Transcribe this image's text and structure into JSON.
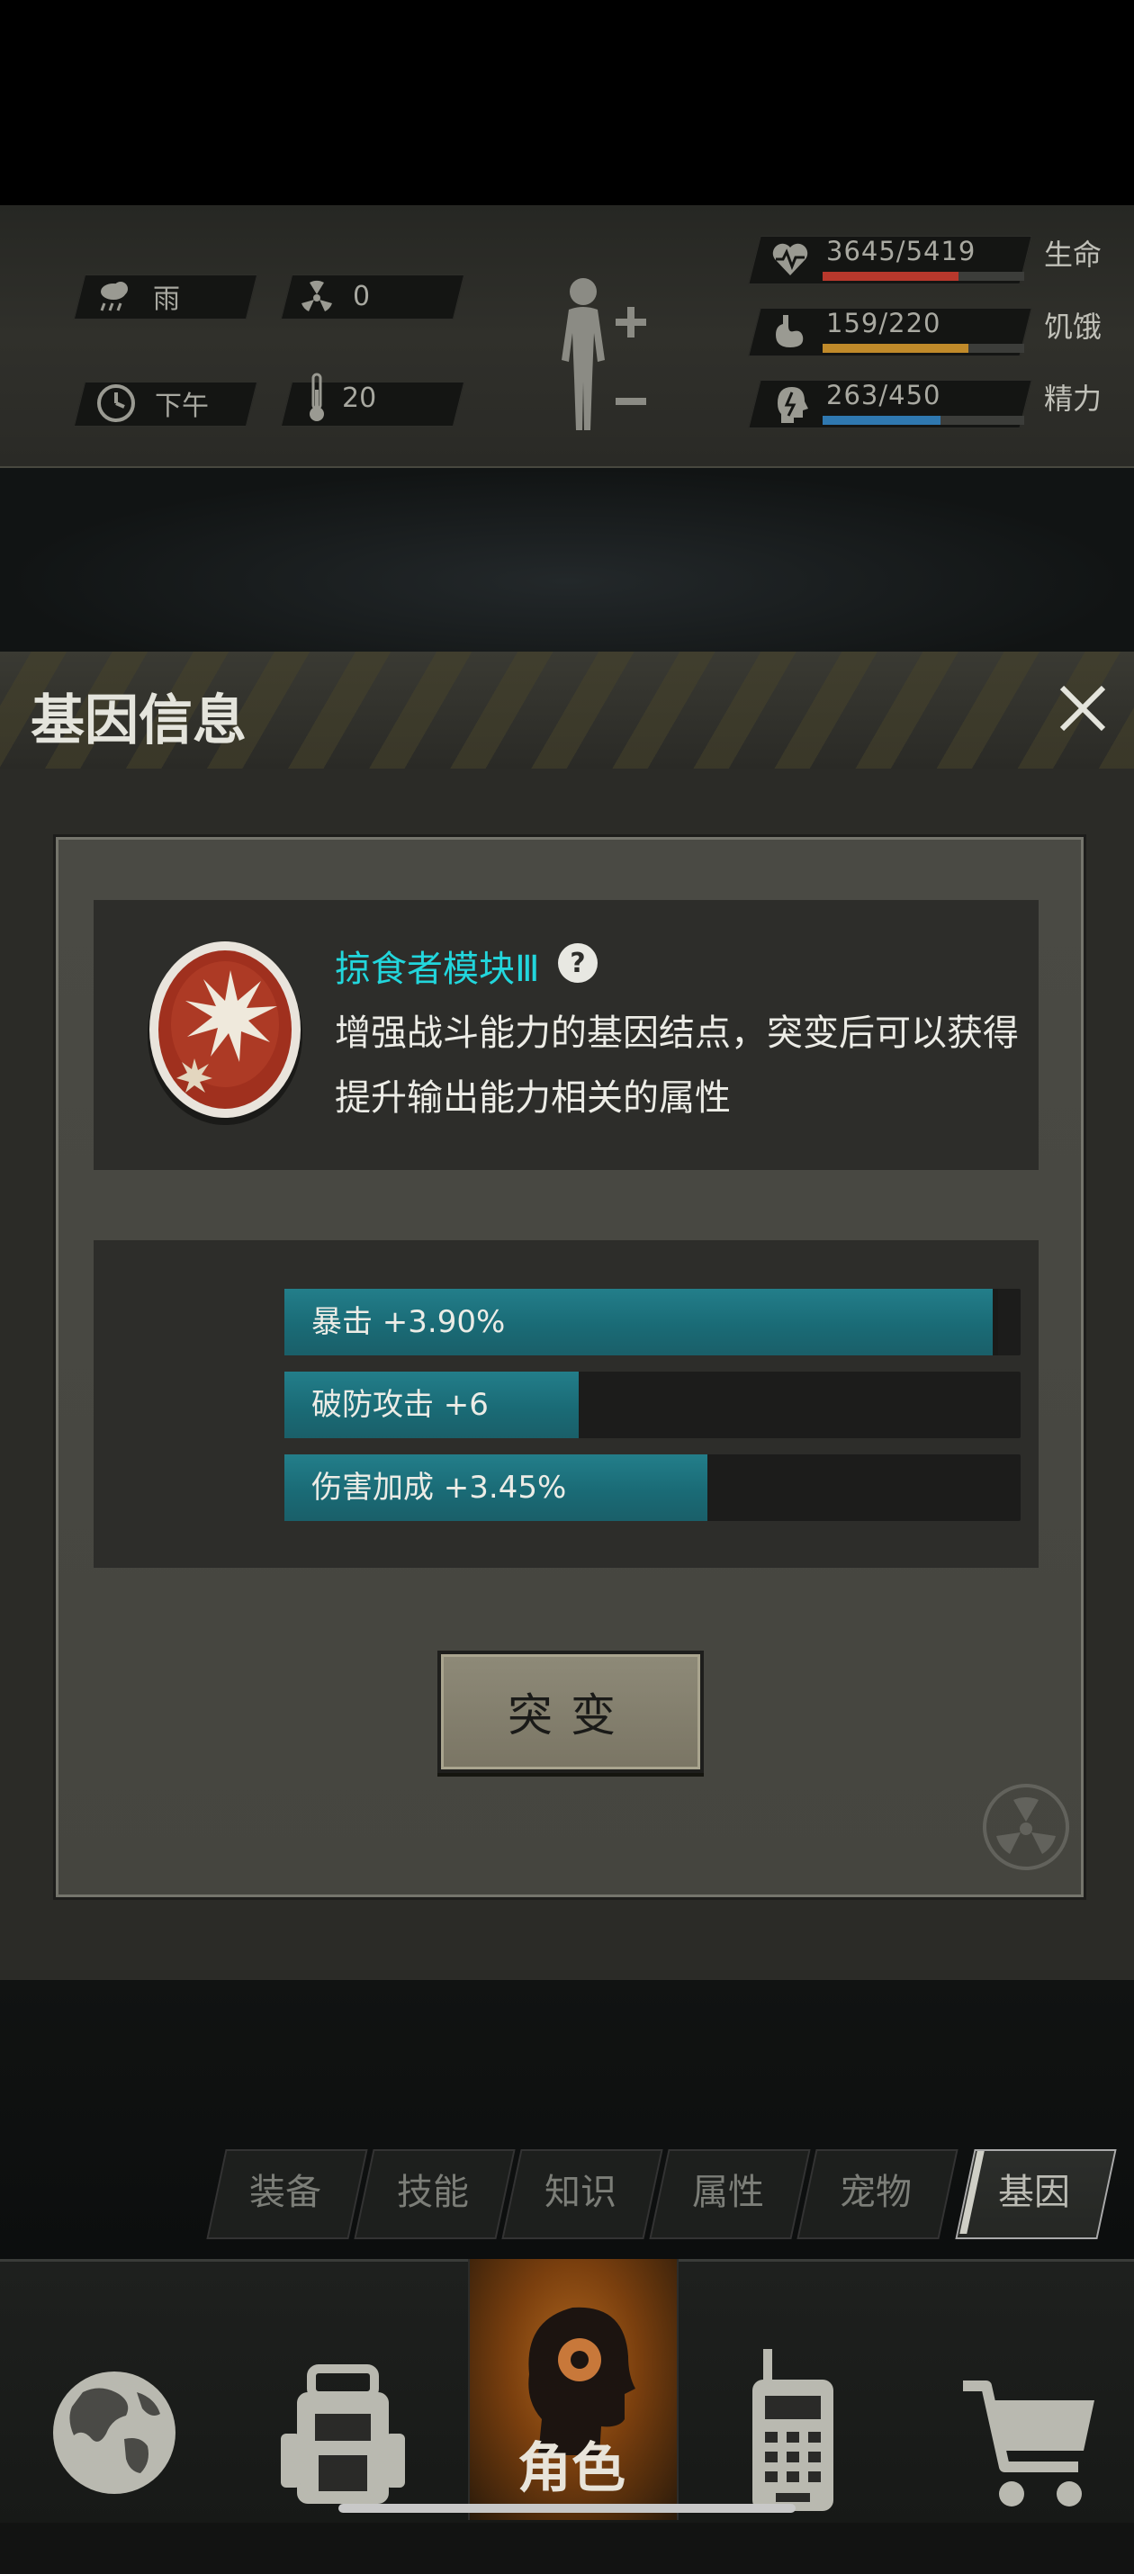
{
  "status": {
    "weather": {
      "icon": "rain-cloud-icon",
      "label": "雨"
    },
    "radiation": {
      "icon": "radiation-icon",
      "value": "0"
    },
    "time": {
      "icon": "clock-icon",
      "label": "下午"
    },
    "temperature": {
      "icon": "thermometer-icon",
      "value": "20"
    },
    "body_icon": "body-adjust-icon",
    "stats": [
      {
        "icon": "heart-rate-icon",
        "value": "3645/5419",
        "label": "生命",
        "fraction": 0.673,
        "color": "#b8382c"
      },
      {
        "icon": "stomach-icon",
        "value": "159/220",
        "label": "饥饿",
        "fraction": 0.723,
        "color": "#c08a2a"
      },
      {
        "icon": "energy-head-icon",
        "value": "263/450",
        "label": "精力",
        "fraction": 0.584,
        "color": "#2f78b0"
      }
    ]
  },
  "dialog": {
    "title": "基因信息",
    "close_icon": "close-icon",
    "gene": {
      "name": "掠食者模块Ⅲ",
      "help_icon": "question-icon",
      "emblem_icon": "predator-gene-emblem-icon",
      "description": "增强战斗能力的基因结点，突变后可以获得提升输出能力相关的属性"
    },
    "attributes": [
      {
        "label": "暴击 +3.90%",
        "fraction": 0.97
      },
      {
        "label": "破防攻击 +6",
        "fraction": 0.4
      },
      {
        "label": "伤害加成 +3.45%",
        "fraction": 0.575
      }
    ],
    "mutate_label": "突变",
    "watermark_icon": "radiation-icon"
  },
  "tabs": [
    {
      "label": "装备",
      "active": false
    },
    {
      "label": "技能",
      "active": false
    },
    {
      "label": "知识",
      "active": false
    },
    {
      "label": "属性",
      "active": false
    },
    {
      "label": "宠物",
      "active": false
    },
    {
      "label": "基因",
      "active": true
    }
  ],
  "bottom_nav": [
    {
      "icon": "globe-icon",
      "label": ""
    },
    {
      "icon": "backpack-icon",
      "label": ""
    },
    {
      "icon": "character-head-icon",
      "label": "角色",
      "active": true
    },
    {
      "icon": "walkie-talkie-icon",
      "label": ""
    },
    {
      "icon": "shopping-cart-icon",
      "label": ""
    }
  ]
}
